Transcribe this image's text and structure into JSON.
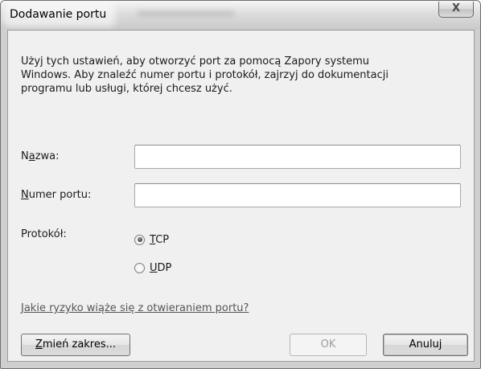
{
  "window": {
    "title": "Dodawanie portu",
    "close_glyph": "X"
  },
  "description": "Użyj tych ustawień, aby otworzyć port za pomocą Zapory systemu\nWindows. Aby znaleźć numer portu i protokół, zajrzyj do dokumentacji\nprogramu lub usługi, której chcesz użyć.",
  "form": {
    "name_label_pre": "N",
    "name_label_ul": "a",
    "name_label_post": "zwa:",
    "name_value": "",
    "port_label_ul": "N",
    "port_label_post": "umer portu:",
    "port_value": "",
    "protocol_label": "Protokół:",
    "protocol_options": [
      {
        "mnemonic": "T",
        "rest": "CP",
        "selected": true
      },
      {
        "mnemonic": "U",
        "rest": "DP",
        "selected": false
      }
    ]
  },
  "link_text": "Jakie ryzyko wiąże się z otwieraniem portu?",
  "buttons": {
    "change_scope_ul": "Z",
    "change_scope_post": "mień zakres...",
    "ok": "OK",
    "ok_enabled": false,
    "cancel": "Anuluj"
  },
  "icons": {
    "close": "close-icon"
  }
}
